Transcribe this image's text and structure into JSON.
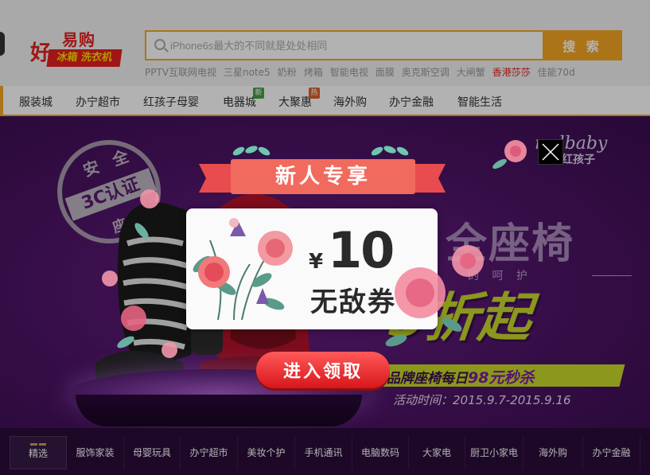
{
  "header": {
    "logo": {
      "line1": "易购",
      "line2": "好",
      "ribbon": "冰箱 洗衣机"
    },
    "search": {
      "placeholder": "iPhone6s最大的不同就是处处相同",
      "button_label": "搜 索"
    },
    "hot_words": [
      {
        "text": "PPTV互联网电视",
        "highlight": false
      },
      {
        "text": "三星note5",
        "highlight": false
      },
      {
        "text": "奶粉",
        "highlight": false
      },
      {
        "text": "烤箱",
        "highlight": false
      },
      {
        "text": "智能电视",
        "highlight": false
      },
      {
        "text": "面膜",
        "highlight": false
      },
      {
        "text": "奥克斯空调",
        "highlight": false
      },
      {
        "text": "大闸蟹",
        "highlight": false
      },
      {
        "text": "香港莎莎",
        "highlight": true
      },
      {
        "text": "佳能70d",
        "highlight": false
      }
    ]
  },
  "nav": {
    "items": [
      {
        "label": "服装城"
      },
      {
        "label": "办宁超市"
      },
      {
        "label": "红孩子母婴"
      },
      {
        "label": "电器城",
        "badge": "新",
        "badge_color": "#44a044"
      },
      {
        "label": "大聚惠",
        "badge": "热",
        "badge_color": "#e0602a"
      },
      {
        "label": "海外购"
      },
      {
        "label": "办宁金融"
      },
      {
        "label": "智能生活"
      }
    ]
  },
  "banner": {
    "stamp": {
      "top": "安 全",
      "middle": "3C认证",
      "bottom": "座"
    },
    "brand": {
      "name": "redbaby",
      "sub": "红孩子"
    },
    "headline": "全座椅",
    "subline": "的 呵 护",
    "discount": "5折起",
    "promo": {
      "prefix": "品牌座椅每日",
      "emphasis": "98元秒杀"
    },
    "date": "活动时间：2015.9.7-2015.9.16"
  },
  "categories": [
    {
      "label": "精选",
      "active": true
    },
    {
      "label": "服饰家装"
    },
    {
      "label": "母婴玩具"
    },
    {
      "label": "办宁超市"
    },
    {
      "label": "美妆个护"
    },
    {
      "label": "手机通讯"
    },
    {
      "label": "电脑数码"
    },
    {
      "label": "大家电"
    },
    {
      "label": "厨卫小家电"
    },
    {
      "label": "海外购"
    },
    {
      "label": "办宁金融"
    }
  ],
  "popup": {
    "title": "新人专享",
    "coupon": {
      "currency": "¥",
      "amount": "10",
      "name": "无敌券"
    },
    "claim_button": "进入领取"
  },
  "colors": {
    "accent": "#f6a623",
    "brand_red": "#e4201f",
    "banner_purple": "#4d1466",
    "promo_green": "#c8d92a",
    "ribbon_red": "#f16a5e"
  }
}
